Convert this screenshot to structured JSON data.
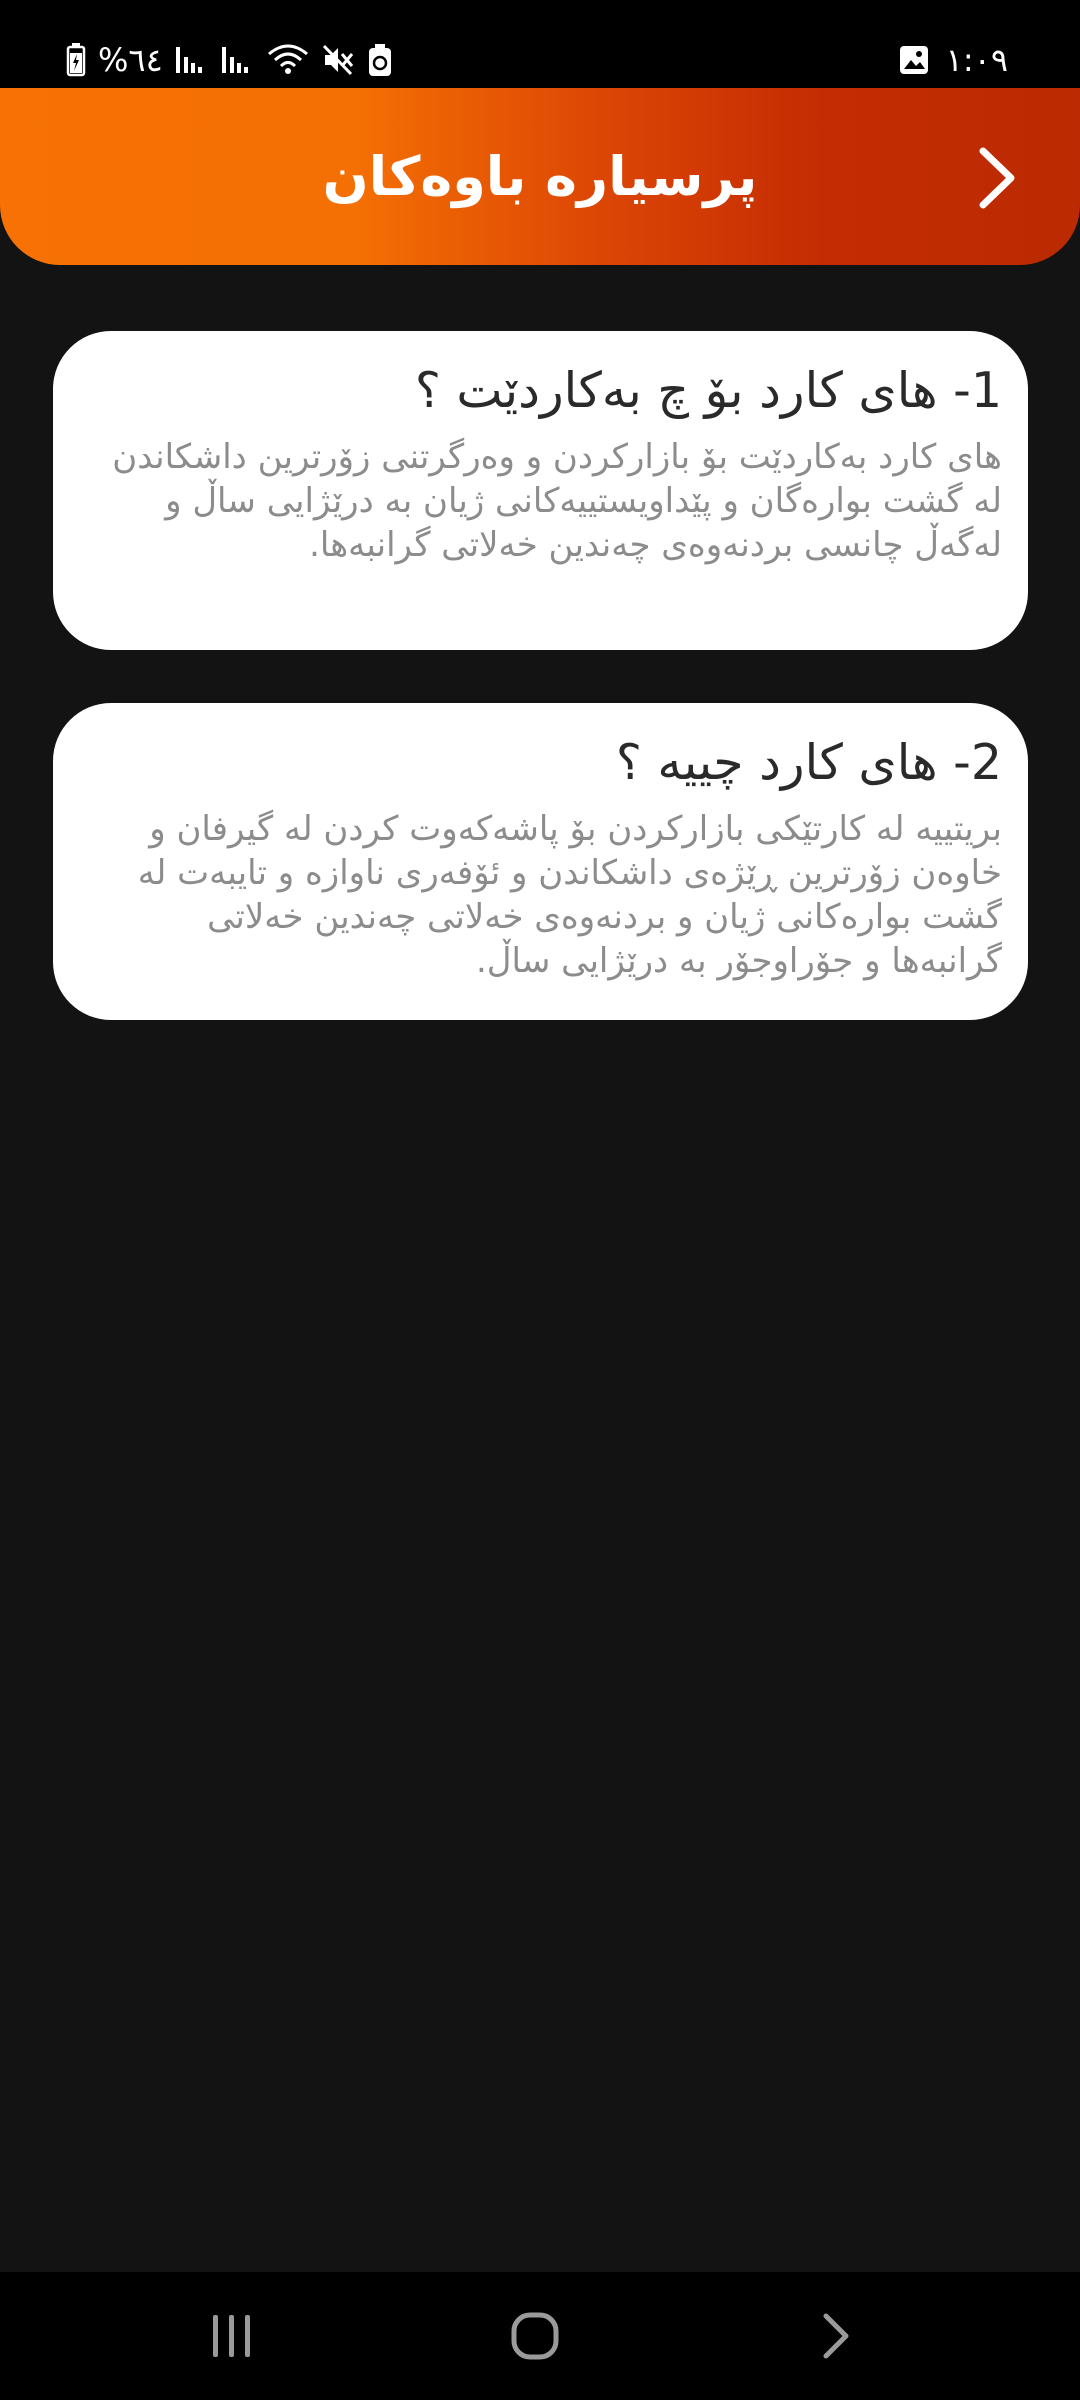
{
  "status_bar": {
    "battery_percent": "%٦٤",
    "time": "١:٠٩"
  },
  "header": {
    "title": "پرسیارە باوەکان"
  },
  "faq": [
    {
      "question": "1- های کارد بۆ چ بەکاردێت ؟",
      "answer": "های کارد بەکاردێت بۆ بازارکردن و وەرگرتنی زۆرترین داشکاندن لە گشت بوارەگان و پێداویستییەکانی ژیان بە درێژایی ساڵ و لەگەڵ چانسی بردنەوەی چەندین خەلاتی گرانبەها."
    },
    {
      "question": "2- های کارد چییە ؟",
      "answer": "بریتییە لە کارتێکی بازارکردن بۆ پاشەکەوت کردن لە گیرفان و خاوەن زۆرترین ڕێژەی داشکاندن و ئۆفەری ناوازە و تایبەت لە گشت بوارەکانی ژیان و بردنەوەی خەلاتی چەندین خەلاتی گرانبەها و جۆراوجۆر بە درێژایی ساڵ."
    }
  ],
  "icons": {
    "back": "chevron-right-icon",
    "nav_recents": "recents-icon",
    "nav_home": "home-icon",
    "nav_back": "nav-back-icon"
  },
  "colors": {
    "header_gradient_start": "#f77104",
    "header_gradient_end": "#bb2a02",
    "background": "#131313",
    "card": "#ffffff",
    "question_text": "#2a2a2a",
    "answer_text": "#8c8c8c"
  }
}
